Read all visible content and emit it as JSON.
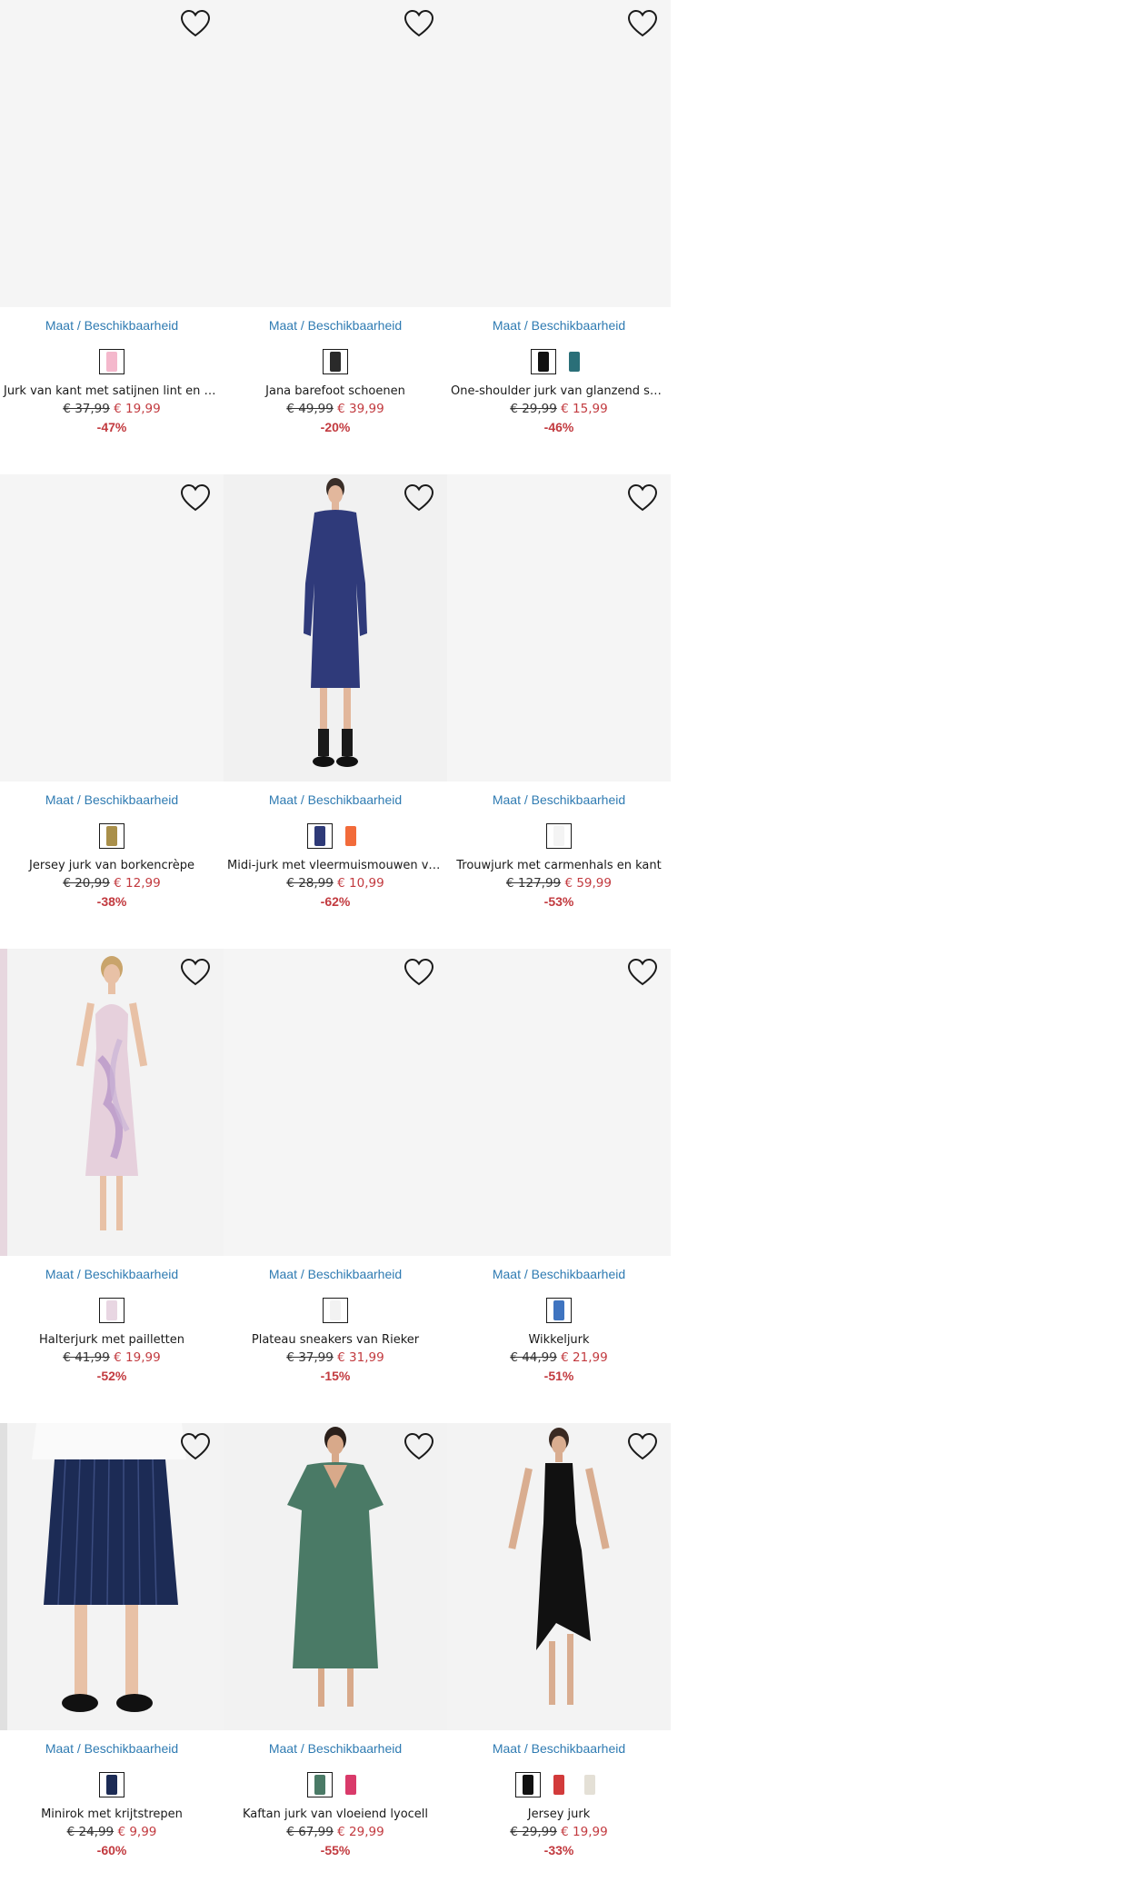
{
  "size_link_label": "Maat / Beschikbaarheid",
  "products": [
    {
      "title": "Jurk van kant met satijnen lint en v...",
      "old_price": "€ 37,99",
      "new_price": "€ 19,99",
      "discount": "-47%",
      "swatches": [
        "#f4b8cc"
      ],
      "image": "blank"
    },
    {
      "title": "Jana barefoot schoenen",
      "old_price": "€ 49,99",
      "new_price": "€ 39,99",
      "discount": "-20%",
      "swatches": [
        "#2a2a2a"
      ],
      "image": "blank"
    },
    {
      "title": "One-shoulder jurk van glanzend satijn",
      "old_price": "€ 29,99",
      "new_price": "€ 15,99",
      "discount": "-46%",
      "swatches": [
        "#111111",
        "#2a6f78"
      ],
      "image": "blank"
    },
    {
      "title": "Jersey jurk van borkencrèpe",
      "old_price": "€ 20,99",
      "new_price": "€ 12,99",
      "discount": "-38%",
      "swatches": [
        "#a98f4a"
      ],
      "image": "blank"
    },
    {
      "title": "Midi-jurk met vleermuismouwen va...",
      "old_price": "€ 28,99",
      "new_price": "€ 10,99",
      "discount": "-62%",
      "swatches": [
        "#2e3a78",
        "#f26b3a"
      ],
      "image": "navy-dress"
    },
    {
      "title": "Trouwjurk met carmenhals en kant",
      "old_price": "€ 127,99",
      "new_price": "€ 59,99",
      "discount": "-53%",
      "swatches": [
        "#f4f4f4"
      ],
      "image": "blank"
    },
    {
      "title": "Halterjurk met pailletten",
      "old_price": "€ 41,99",
      "new_price": "€ 19,99",
      "discount": "-52%",
      "swatches": [
        "#e8d6e2"
      ],
      "image": "floral-dress"
    },
    {
      "title": "Plateau sneakers van Rieker",
      "old_price": "€ 37,99",
      "new_price": "€ 31,99",
      "discount": "-15%",
      "swatches": [
        "#f2f2f2"
      ],
      "image": "blank"
    },
    {
      "title": "Wikkeljurk",
      "old_price": "€ 44,99",
      "new_price": "€ 21,99",
      "discount": "-51%",
      "swatches": [
        "#3f74c0"
      ],
      "image": "blank"
    },
    {
      "title": "Minirok met krijtstrepen",
      "old_price": "€ 24,99",
      "new_price": "€ 9,99",
      "discount": "-60%",
      "swatches": [
        "#1c2b55"
      ],
      "image": "pinstripe-skirt"
    },
    {
      "title": "Kaftan jurk van vloeiend lyocell",
      "old_price": "€ 67,99",
      "new_price": "€ 29,99",
      "discount": "-55%",
      "swatches": [
        "#4a7a66",
        "#d93a6a"
      ],
      "image": "green-kaftan"
    },
    {
      "title": "Jersey jurk",
      "old_price": "€ 29,99",
      "new_price": "€ 19,99",
      "discount": "-33%",
      "swatches": [
        "#111111",
        "#d23b3b",
        "#e4e0d6"
      ],
      "image": "black-dress"
    }
  ]
}
